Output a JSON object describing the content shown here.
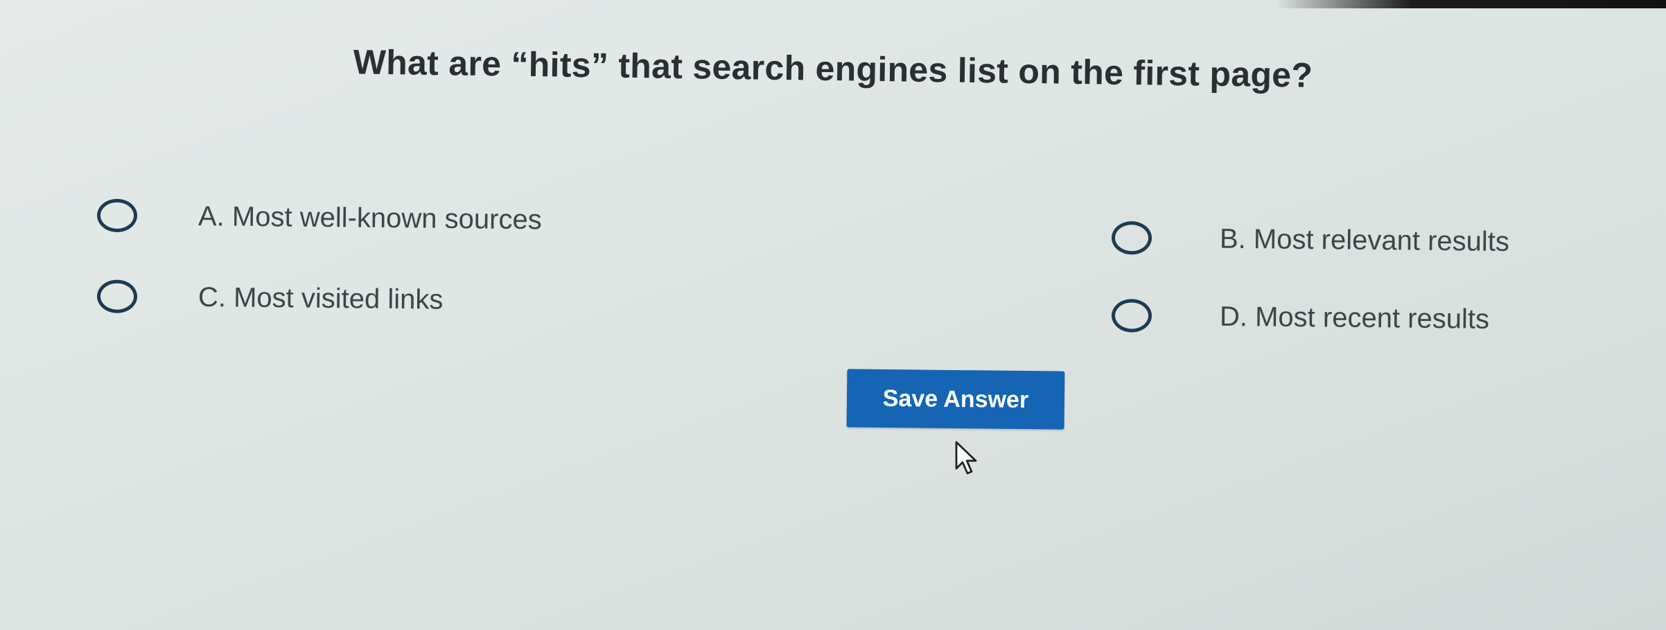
{
  "question": {
    "text": "What are “hits” that search engines list on the first page?"
  },
  "options": [
    {
      "id": "A",
      "label": "A. Most well-known sources",
      "selected": false
    },
    {
      "id": "B",
      "label": "B. Most relevant results",
      "selected": false
    },
    {
      "id": "C",
      "label": "C. Most visited links",
      "selected": false
    },
    {
      "id": "D",
      "label": "D. Most recent results",
      "selected": false
    }
  ],
  "actions": {
    "save_label": "Save Answer"
  },
  "colors": {
    "button": "#1565b4",
    "radio_border": "#1f3b52",
    "background": "#dfe6e4"
  },
  "icons": {
    "pointer": "mouse-pointer-icon"
  }
}
